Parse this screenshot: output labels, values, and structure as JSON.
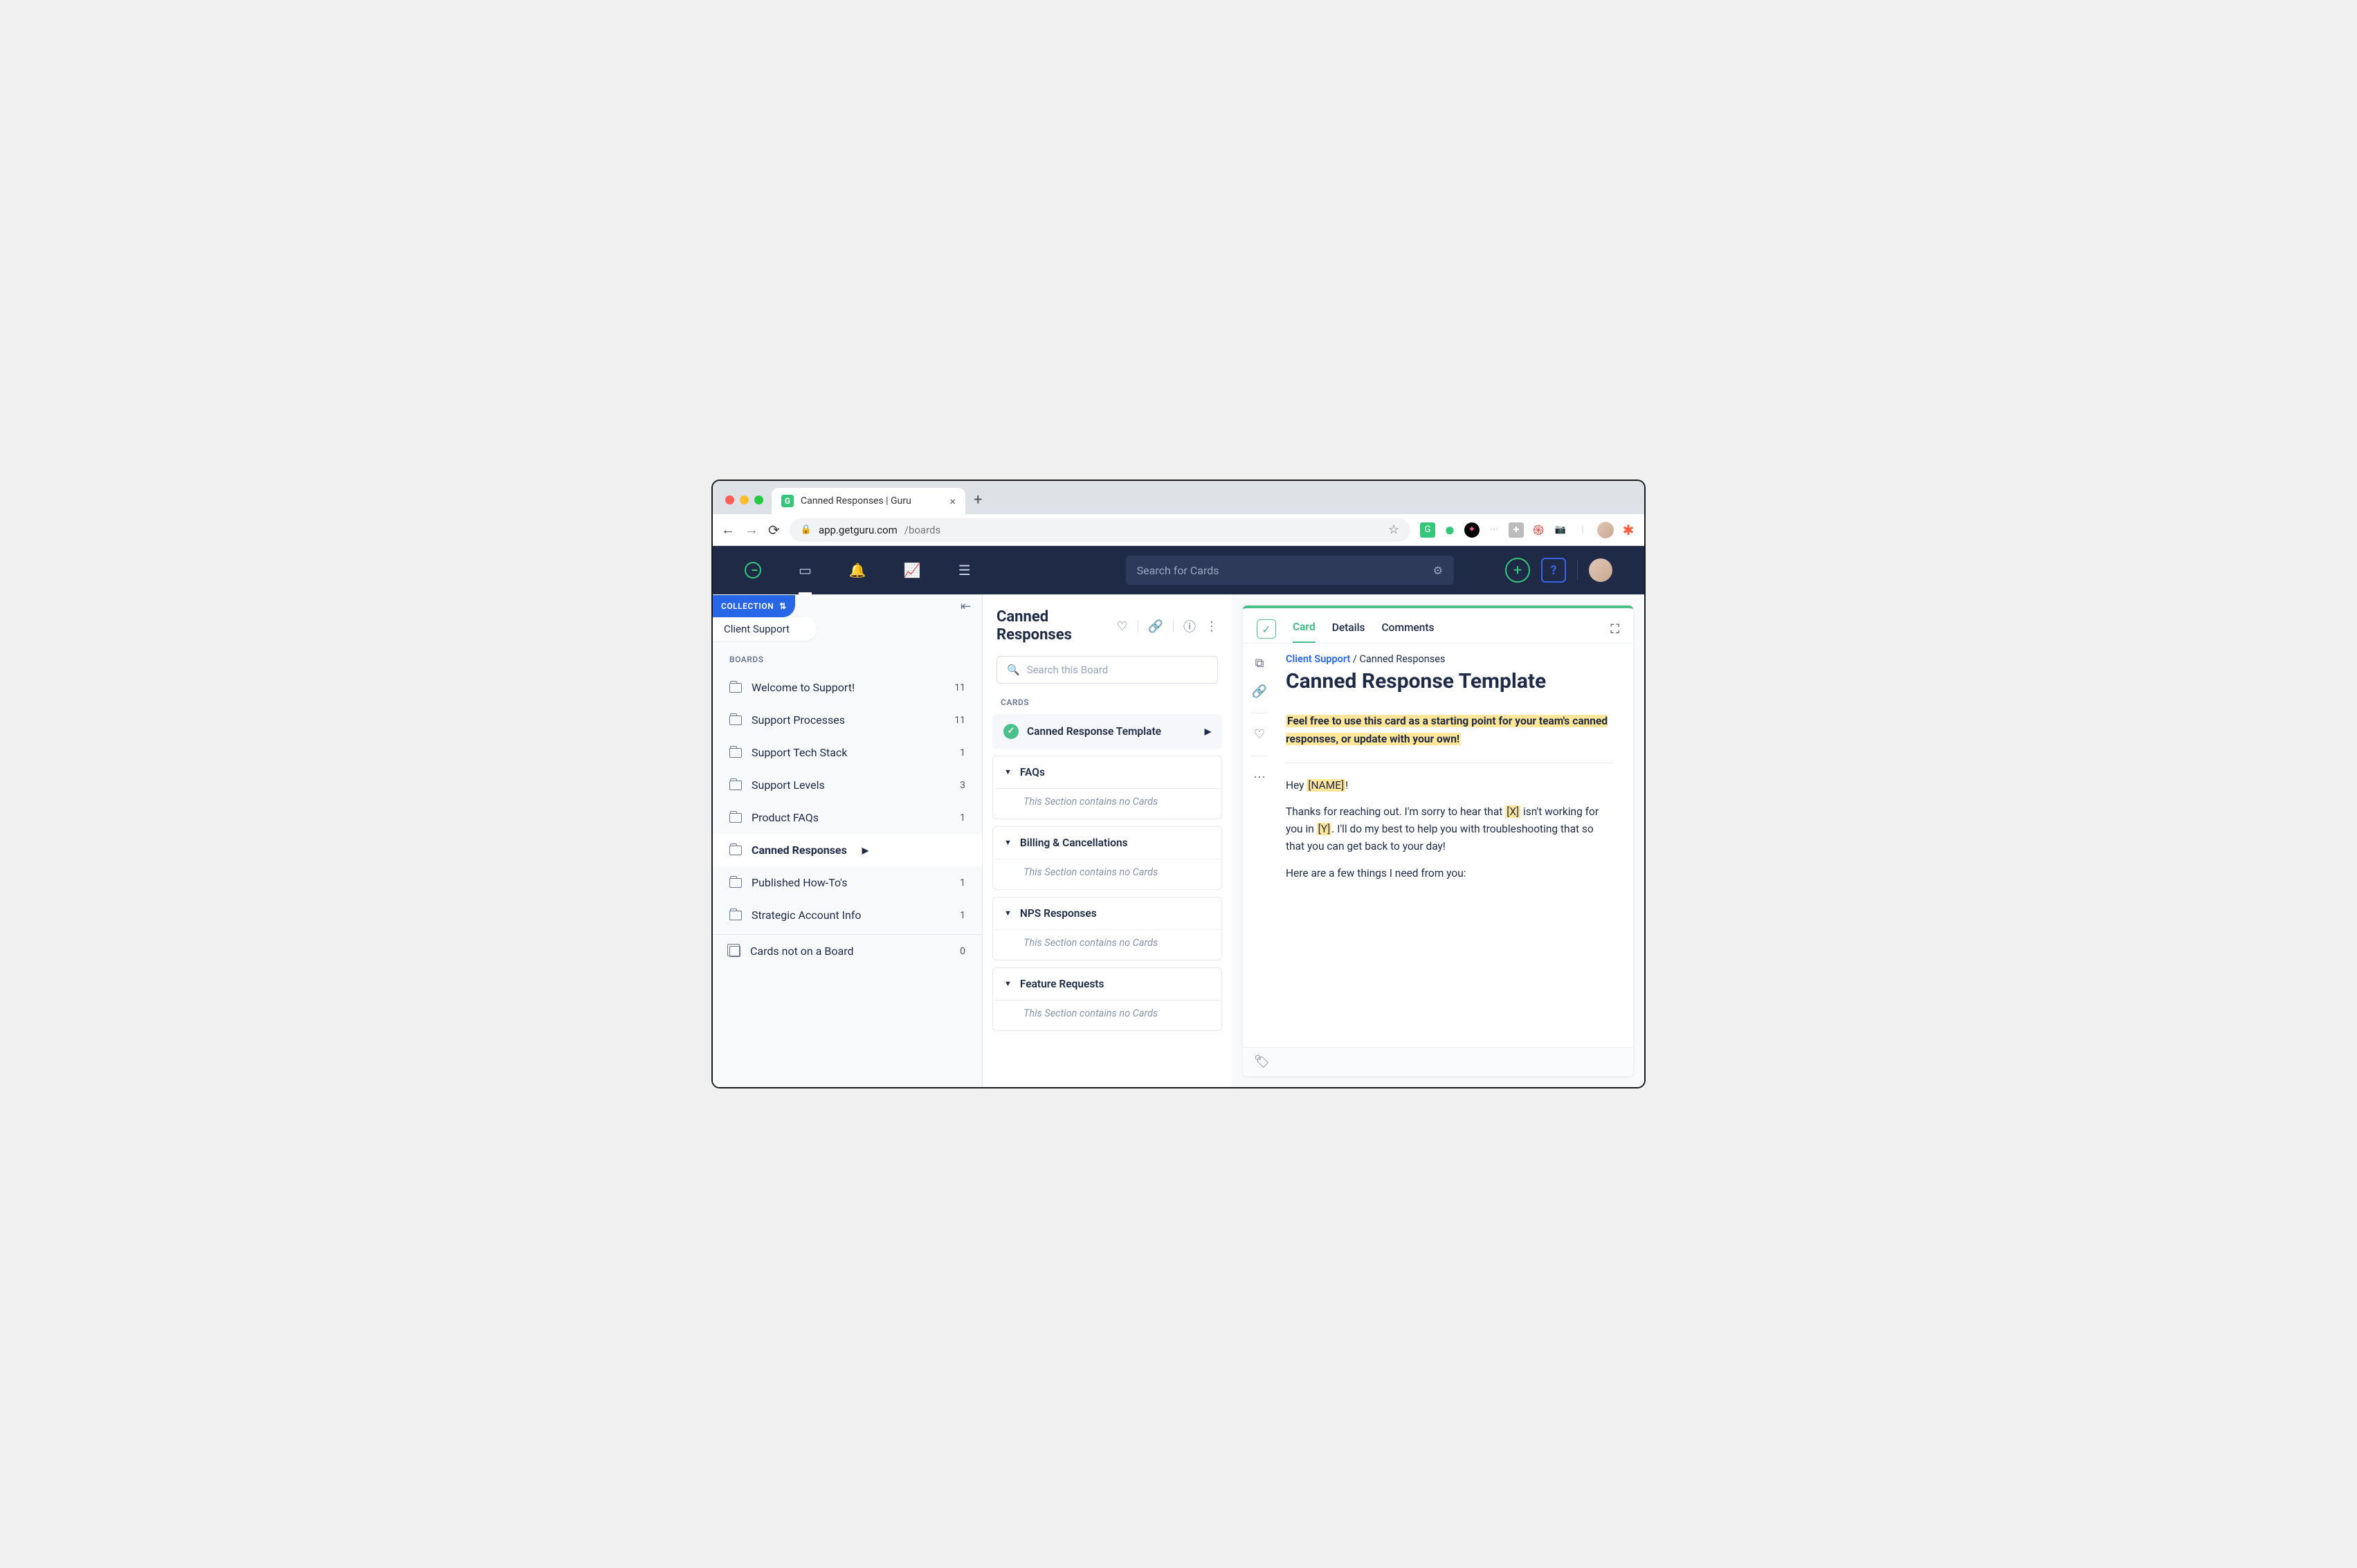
{
  "browser": {
    "tab_title": "Canned Responses | Guru",
    "url_host": "app.getguru.com",
    "url_path": "/boards"
  },
  "header": {
    "search_placeholder": "Search for Cards",
    "add_label": "+",
    "help_label": "?"
  },
  "sidebar": {
    "collection_label": "COLLECTION",
    "collection_name": "Client Support",
    "boards_label": "BOARDS",
    "boards": [
      {
        "name": "Welcome to Support!",
        "count": "11"
      },
      {
        "name": "Support Processes",
        "count": "11"
      },
      {
        "name": "Support Tech Stack",
        "count": "1"
      },
      {
        "name": "Support Levels",
        "count": "3"
      },
      {
        "name": "Product FAQs",
        "count": "1"
      },
      {
        "name": "Canned Responses",
        "count": ""
      },
      {
        "name": "Published How-To's",
        "count": "1"
      },
      {
        "name": "Strategic Account Info",
        "count": "1"
      }
    ],
    "loose_cards": {
      "name": "Cards not on a Board",
      "count": "0"
    }
  },
  "board": {
    "title": "Canned Responses",
    "search_placeholder": "Search this Board",
    "cards_label": "CARDS",
    "active_card": "Canned Response Template",
    "empty_text": "This Section contains no Cards",
    "sections": [
      {
        "name": "FAQs"
      },
      {
        "name": "Billing & Cancellations"
      },
      {
        "name": "NPS Responses"
      },
      {
        "name": "Feature Requests"
      }
    ]
  },
  "card": {
    "tabs": {
      "card": "Card",
      "details": "Details",
      "comments": "Comments"
    },
    "breadcrumb_collection": "Client Support",
    "breadcrumb_sep": " / ",
    "breadcrumb_board": "Canned Responses",
    "title": "Canned Response Template",
    "intro": "Feel free to use this card as a starting point for your team's canned responses, or update with your own!",
    "greeting_pre": "Hey ",
    "greeting_token": "[NAME]",
    "greeting_post": "!",
    "p1_a": "Thanks for reaching out. I'm sorry to hear that ",
    "p1_tok1": "[X]",
    "p1_b": " isn't working for you in ",
    "p1_tok2": "[Y]",
    "p1_c": ". I'll do my best to help you with troubleshooting that so that you can get back to your day!",
    "p2": "Here are a few things I need from you:"
  }
}
